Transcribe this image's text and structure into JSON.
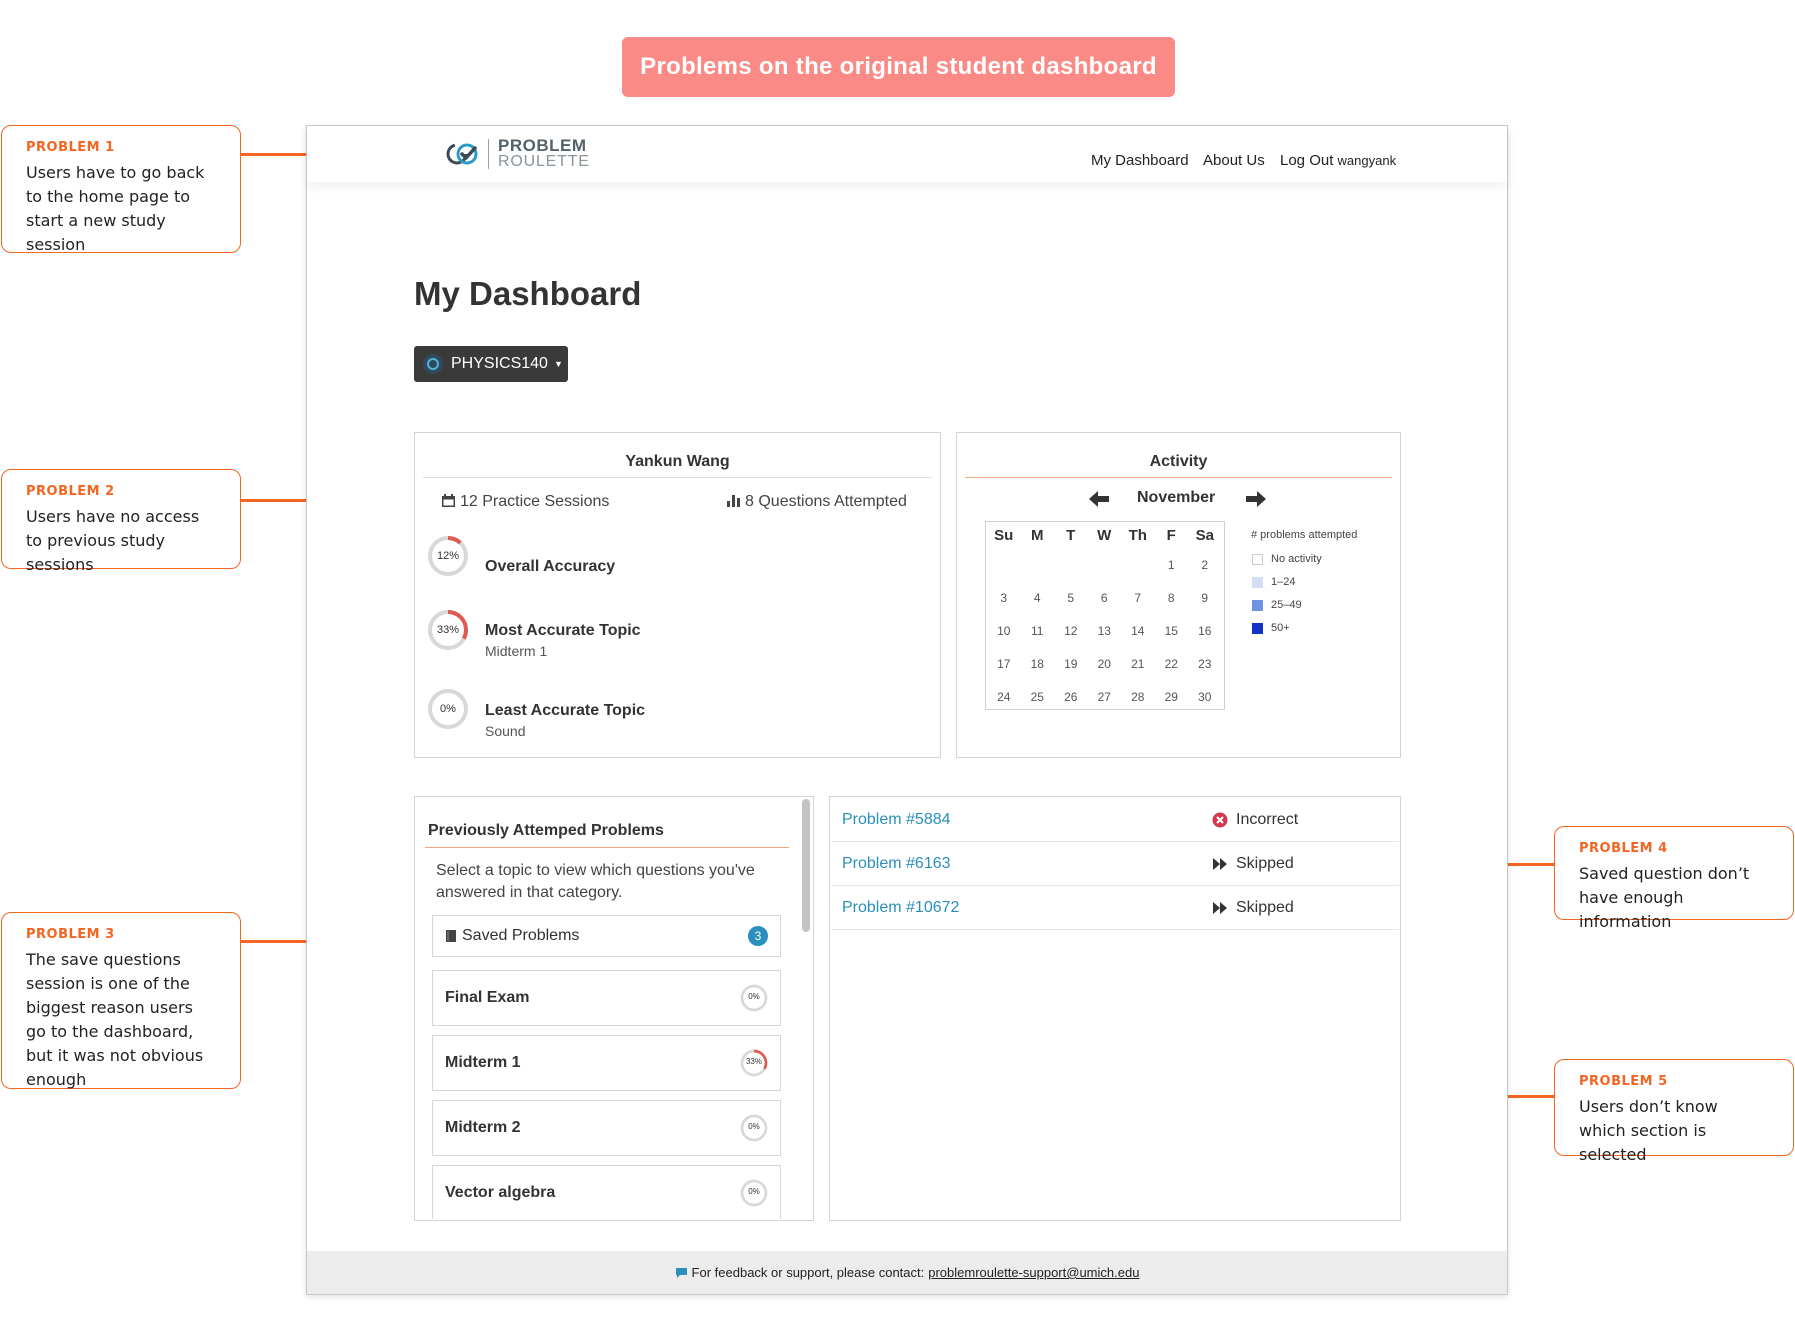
{
  "banner": "Problems on the original student dashboard",
  "callouts": [
    {
      "title": "PROBLEM 1",
      "body": "Users have to go back to the home page to start a new study session"
    },
    {
      "title": "PROBLEM 2",
      "body": "Users have no access to previous study sessions"
    },
    {
      "title": "PROBLEM 3",
      "body": "The save questions session is one of the biggest reason users go to the dashboard, but it was not obvious enough"
    },
    {
      "title": "PROBLEM 4",
      "body": "Saved question don’t have enough information"
    },
    {
      "title": "PROBLEM 5",
      "body": "Users don’t know which section is selected"
    }
  ],
  "nav": {
    "logo_line1": "PROBLEM",
    "logo_line2": "ROULETTE",
    "dashboard": "My Dashboard",
    "about": "About Us",
    "logout": "Log Out",
    "username": "wangyank"
  },
  "page_title": "My Dashboard",
  "course": "PHYSICS140",
  "profile": {
    "name": "Yankun Wang",
    "sessions": "12 Practice Sessions",
    "attempted": "8 Questions Attempted",
    "stats": [
      {
        "pct": "12%",
        "value": 0.12,
        "title": "Overall Accuracy",
        "sub": ""
      },
      {
        "pct": "33%",
        "value": 0.33,
        "title": "Most Accurate Topic",
        "sub": "Midterm 1"
      },
      {
        "pct": "0%",
        "value": 0,
        "title": "Least Accurate Topic",
        "sub": "Sound"
      }
    ]
  },
  "activity": {
    "title": "Activity",
    "month": "November",
    "weekdays": [
      "Su",
      "M",
      "T",
      "W",
      "Th",
      "F",
      "Sa"
    ],
    "weeks": [
      [
        "",
        "",
        "",
        "",
        "",
        "1",
        "2"
      ],
      [
        "3",
        "4",
        "5",
        "6",
        "7",
        "8",
        "9"
      ],
      [
        "10",
        "11",
        "12",
        "13",
        "14",
        "15",
        "16"
      ],
      [
        "17",
        "18",
        "19",
        "20",
        "21",
        "22",
        "23"
      ],
      [
        "24",
        "25",
        "26",
        "27",
        "28",
        "29",
        "30"
      ]
    ],
    "legend_title": "# problems attempted",
    "legend": [
      {
        "label": "No activity",
        "color": "#ffffff"
      },
      {
        "label": "1–24",
        "color": "#d5dff3"
      },
      {
        "label": "25–49",
        "color": "#6e93e0"
      },
      {
        "label": "50+",
        "color": "#1232c8"
      }
    ]
  },
  "previous": {
    "title": "Previously Attemped Problems",
    "desc": "Select a topic to view which questions you've answered in that category.",
    "saved_label": "Saved Problems",
    "saved_count": "3",
    "topics": [
      {
        "name": "Final Exam",
        "pct": "0%",
        "value": 0
      },
      {
        "name": "Midterm 1",
        "pct": "33%",
        "value": 0.33
      },
      {
        "name": "Midterm 2",
        "pct": "0%",
        "value": 0
      },
      {
        "name": "Vector algebra",
        "pct": "0%",
        "value": 0
      }
    ]
  },
  "problems": [
    {
      "id": "Problem #5884",
      "status": "Incorrect",
      "icon": "incorrect-icon"
    },
    {
      "id": "Problem #6163",
      "status": "Skipped",
      "icon": "skip-icon"
    },
    {
      "id": "Problem #10672",
      "status": "Skipped",
      "icon": "skip-icon"
    }
  ],
  "footer": {
    "text": "For feedback or support, please contact:",
    "email": "problemroulette-support@umich.edu"
  },
  "colors": {
    "accent": "#f26522",
    "banner": "#fa8a86",
    "link": "#2a8fbd",
    "ring": "#e05a4f"
  }
}
